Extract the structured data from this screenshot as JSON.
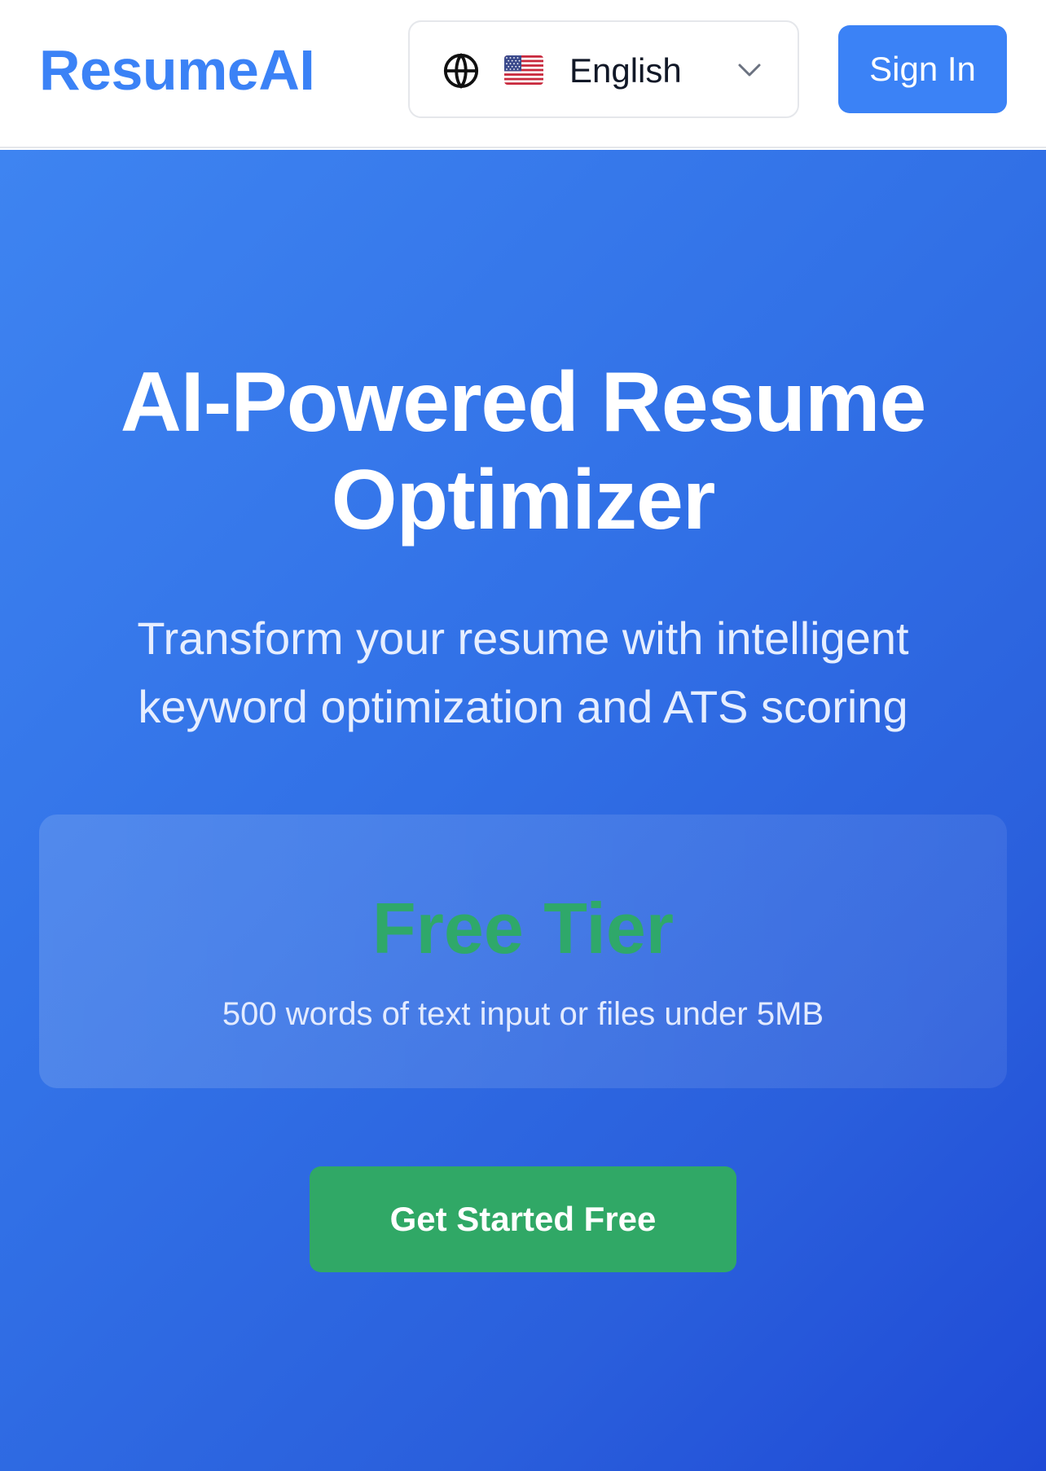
{
  "header": {
    "logo": "ResumeAI",
    "language": {
      "icon": "globe-icon",
      "flag": "us-flag-icon",
      "selected": "English",
      "dropdown_icon": "chevron-down-icon"
    },
    "sign_in_label": "Sign In"
  },
  "hero": {
    "title_lines": [
      "AI-Powered Resume",
      "Optimizer"
    ],
    "subtitle_lines": [
      "Transform your resume with intelligent",
      "keyword optimization and ATS scoring"
    ],
    "tier": {
      "title": "Free Tier",
      "description": "500 words of text input or files under 5MB"
    },
    "cta_label": "Get Started Free"
  },
  "colors": {
    "brand": "#3b82f6",
    "cta_green": "#30a866",
    "tier_green": "#2fa86a",
    "hero_gradient_start": "#3e84f1",
    "hero_gradient_end": "#1f4ad6"
  }
}
